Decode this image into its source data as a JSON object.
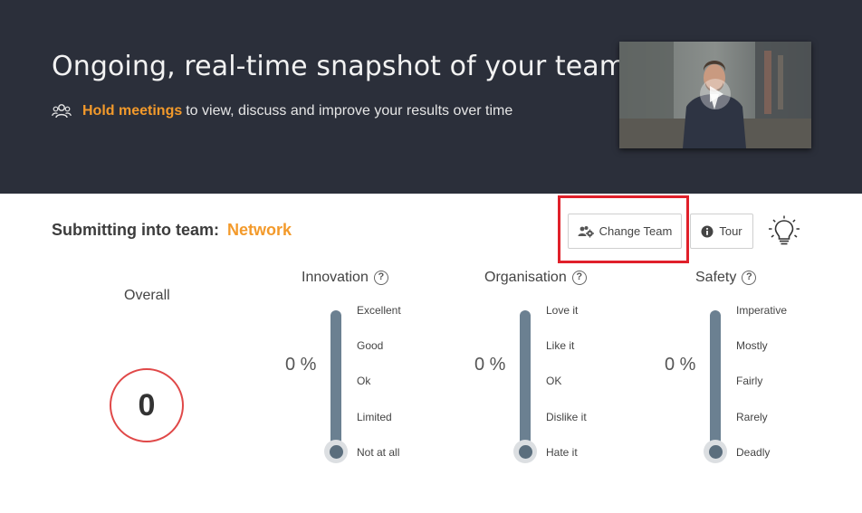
{
  "hero": {
    "title": "Ongoing, real-time snapshot of your team",
    "subtitle_link": "Hold meetings",
    "subtitle_rest": "to view, discuss and improve your results over time"
  },
  "team": {
    "label": "Submitting into team:",
    "name": "Network"
  },
  "actions": {
    "change_team": "Change Team",
    "tour": "Tour"
  },
  "overall": {
    "label": "Overall",
    "value": "0"
  },
  "metrics": [
    {
      "title": "Innovation",
      "percent": "0 %",
      "levels": [
        "Excellent",
        "Good",
        "Ok",
        "Limited",
        "Not at all"
      ]
    },
    {
      "title": "Organisation",
      "percent": "0 %",
      "levels": [
        "Love it",
        "Like it",
        "OK",
        "Dislike it",
        "Hate it"
      ]
    },
    {
      "title": "Safety",
      "percent": "0 %",
      "levels": [
        "Imperative",
        "Mostly",
        "Fairly",
        "Rarely",
        "Deadly"
      ]
    }
  ],
  "colors": {
    "header_bg": "#2b2f3a",
    "accent": "#f39a2b",
    "highlight": "#e0202a",
    "slider": "#6b8091",
    "overall_ring": "#e04848"
  }
}
